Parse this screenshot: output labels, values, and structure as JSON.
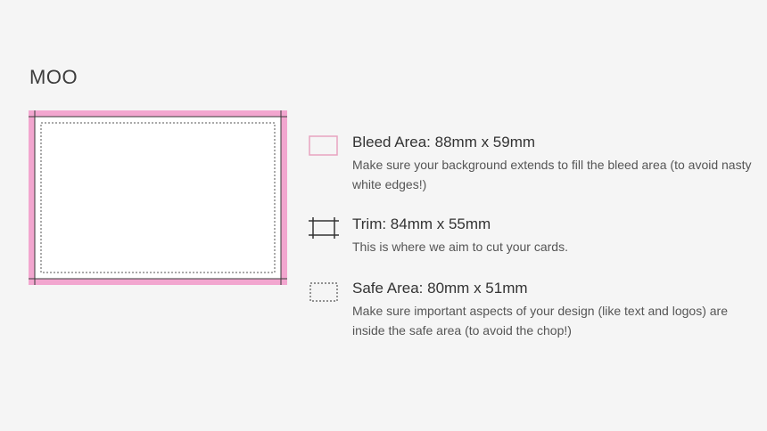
{
  "brand": {
    "name": "MOO"
  },
  "colors": {
    "background": "#f5f5f5",
    "bleed": "#f2a6cf",
    "bleed_swatch_border": "#e8a3c0",
    "trim": "#333333",
    "safe": "#555555",
    "card": "#ffffff"
  },
  "legend": {
    "bleed": {
      "title": "Bleed Area: 88mm x 59mm",
      "description": "Make sure your background extends to fill the bleed area (to avoid nasty white edges!)"
    },
    "trim": {
      "title": "Trim: 84mm x 55mm",
      "description": "This is where we aim to cut your cards."
    },
    "safe": {
      "title": "Safe Area: 80mm x 51mm",
      "description": "Make sure important aspects of your design (like text and logos) are inside the safe area (to avoid the chop!)"
    }
  }
}
